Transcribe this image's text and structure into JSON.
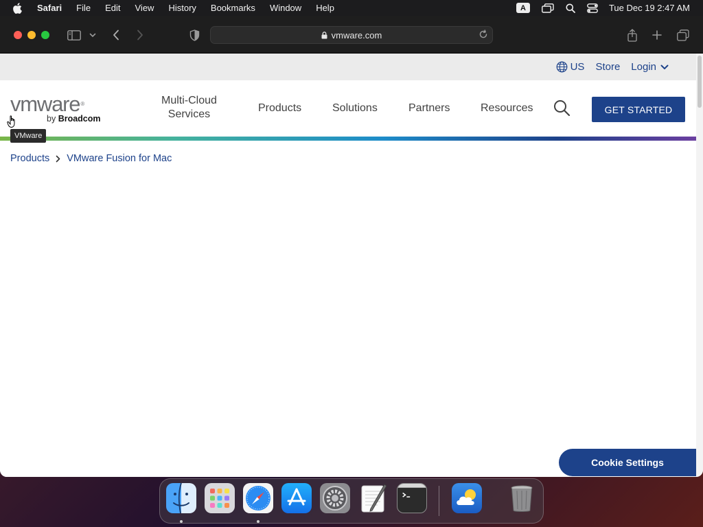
{
  "menubar": {
    "app_name": "Safari",
    "menus": [
      "File",
      "Edit",
      "View",
      "History",
      "Bookmarks",
      "Window",
      "Help"
    ],
    "input_source": "A",
    "clock": "Tue Dec 19  2:47 AM"
  },
  "browser": {
    "address": "vmware.com"
  },
  "page": {
    "utility": {
      "region": "US",
      "store": "Store",
      "login": "Login"
    },
    "logo": {
      "wordmark": "vmware",
      "registered": "®",
      "by_prefix": "by",
      "by_brand": "Broadcom",
      "tooltip": "VMware"
    },
    "nav": {
      "multicloud_line1": "Multi-Cloud",
      "multicloud_line2": "Services",
      "products": "Products",
      "solutions": "Solutions",
      "partners": "Partners",
      "resources": "Resources",
      "cta": "GET STARTED"
    },
    "breadcrumb": {
      "root": "Products",
      "current": "VMware Fusion for Mac"
    },
    "cookie_button": "Cookie Settings"
  },
  "dock": {
    "apps": [
      "finder-icon",
      "launchpad-icon",
      "safari-icon",
      "app-store-icon",
      "system-preferences-icon",
      "textedit-icon",
      "terminal-icon",
      "weather-icon",
      "trash-icon"
    ]
  },
  "colors": {
    "brand_blue": "#1d428a",
    "menubar_bg": "#1c1c1e",
    "toolbar_bg": "#1e1e1e"
  }
}
